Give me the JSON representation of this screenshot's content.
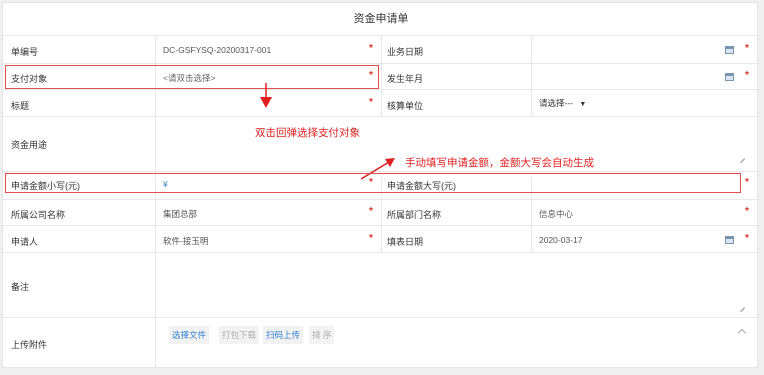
{
  "form": {
    "title": "资金申请单"
  },
  "fields": {
    "doc_no": {
      "label": "单编号",
      "value": "DC-GSFYSQ-20200317-001"
    },
    "biz_date": {
      "label": "业务日期",
      "value": ""
    },
    "payee": {
      "label": "支付对象",
      "placeholder": "<请双击选择>"
    },
    "occur_month": {
      "label": "发生年月",
      "value": ""
    },
    "subject": {
      "label": "标题",
      "value": ""
    },
    "accounting_unit": {
      "label": "核算单位",
      "value": "请选择---",
      "arrow": "▼"
    },
    "purpose": {
      "label": "资金用途",
      "value": ""
    },
    "amount_lower": {
      "label": "申请金额小写(元)",
      "value": "¥"
    },
    "amount_upper": {
      "label": "申请金额大写(元)",
      "value": ""
    },
    "company": {
      "label": "所属公司名称",
      "value": "集团总部"
    },
    "department": {
      "label": "所属部门名称",
      "value": "信息中心"
    },
    "applicant": {
      "label": "申请人",
      "value": "软件-接玉明"
    },
    "fill_date": {
      "label": "填表日期",
      "value": "2020-03-17"
    },
    "remark": {
      "label": "备注",
      "value": ""
    },
    "attachments": {
      "label": "上传附件",
      "buttons": [
        "选择文件",
        "打包下载",
        "扫码上传",
        "排 序"
      ]
    }
  },
  "required_mark": "*",
  "annotations": {
    "payee_tip": "双击回弹选择支付对象",
    "amount_tip": "手动填写申请金额，金额大写会自动生成"
  },
  "colors": {
    "required": "#e03030",
    "annotation": "#e02020",
    "link": "#2d7fd3",
    "border": "#e8e8e8"
  }
}
